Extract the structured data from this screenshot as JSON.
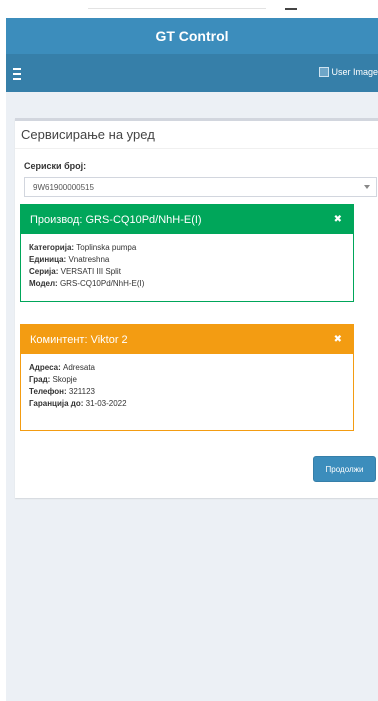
{
  "app": {
    "title": "GT Control"
  },
  "navbar": {
    "user_image_alt": "User Image"
  },
  "page": {
    "title": "Сервисирање на уред"
  },
  "serial": {
    "label": "Сериски број:",
    "value": "9W61900000515"
  },
  "product": {
    "header": "Производ: GRS-CQ10Pd/NhH-E(I)",
    "rows": [
      {
        "label": "Категорија:",
        "value": "Toplinska pumpa"
      },
      {
        "label": "Единица:",
        "value": "Vnatreshna"
      },
      {
        "label": "Серија:",
        "value": "VERSATI III Split"
      },
      {
        "label": "Модел:",
        "value": "GRS-CQ10Pd/NhH-E(I)"
      }
    ]
  },
  "client": {
    "header": "Коминтент: Viktor 2",
    "rows": [
      {
        "label": "Адреса:",
        "value": "Adresata"
      },
      {
        "label": "Град:",
        "value": "Skopje"
      },
      {
        "label": "Телефон:",
        "value": "321123"
      },
      {
        "label": "Гаранција до:",
        "value": "31-03-2022"
      }
    ]
  },
  "actions": {
    "continue_label": "Продолжи"
  },
  "icons": {
    "close": "close-icon",
    "menu": "menu-icon",
    "dropdown": "chevron-down-icon"
  },
  "colors": {
    "primary": "#3c8dbc",
    "success": "#00a65a",
    "warning": "#f39c12",
    "background": "#ecf0f5"
  }
}
